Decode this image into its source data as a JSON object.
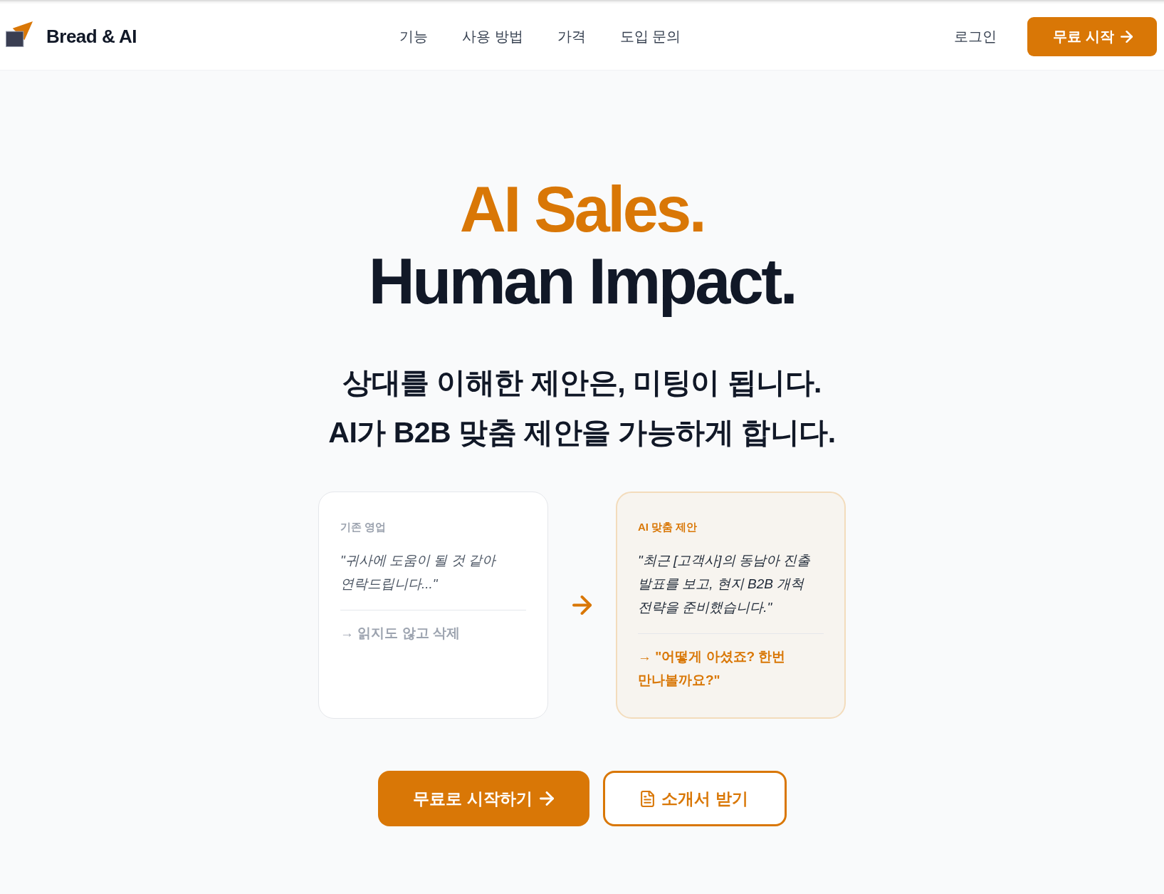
{
  "header": {
    "logo": {
      "text": "Bread & AI"
    },
    "nav": [
      "기능",
      "사용 방법",
      "가격",
      "도입 문의"
    ],
    "login": "로그인",
    "cta": "무료 시작"
  },
  "hero": {
    "headline": [
      {
        "text": "AI Sales.",
        "accent": true
      },
      {
        "text": "Human Impact.",
        "accent": false
      }
    ],
    "subheadline": [
      "상대를 이해한 제안은, 미팅이 됩니다.",
      "AI가 B2B 맞춤 제안을 가능하게 합니다."
    ],
    "comparison": [
      {
        "kind": "before",
        "label": "기존 영업",
        "quote": "\"귀사에 도움이 될 것 같아 연락드립니다...\"",
        "result": "→ 읽지도 않고 삭제"
      },
      {
        "kind": "after",
        "label": "AI 맞춤 제안",
        "quote": "\"최근 [고객사]의 동남아 진출 발표를 보고, 현지 B2B 개척 전략을 준비했습니다.\"",
        "result": "→ \"어떻게 아셨죠? 한번 만나볼까요?\""
      }
    ],
    "buttons": [
      {
        "kind": "primary",
        "label": "무료로 시작하기"
      },
      {
        "kind": "secondary",
        "label": "소개서 받기"
      }
    ]
  }
}
